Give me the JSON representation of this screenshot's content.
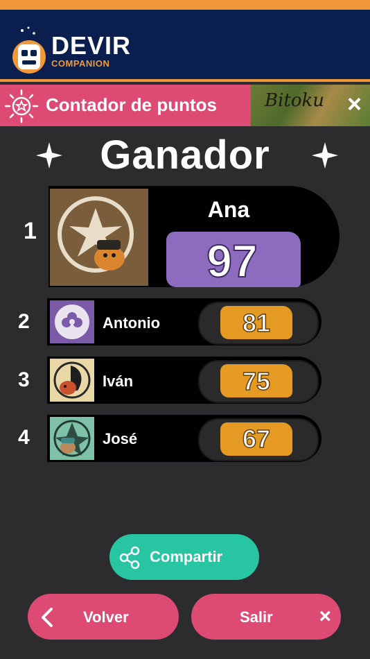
{
  "header": {
    "brand": "DEVIR",
    "brand_sub": "COMPANION"
  },
  "titlebar": {
    "title": "Contador de puntos",
    "banner_game": "Bitoku",
    "close_icon": "×"
  },
  "winner": {
    "title": "Ganador",
    "star_icon": "✦"
  },
  "players": [
    {
      "rank": "1",
      "name": "Ana",
      "score": "97"
    },
    {
      "rank": "2",
      "name": "Antonio",
      "score": "81"
    },
    {
      "rank": "3",
      "name": "Iván",
      "score": "75"
    },
    {
      "rank": "4",
      "name": "José",
      "score": "67"
    }
  ],
  "buttons": {
    "share": "Compartir",
    "back": "Volver",
    "exit": "Salir",
    "exit_icon": "×"
  },
  "colors": {
    "accent_orange": "#f0983a",
    "header_navy": "#0b1f4e",
    "pink": "#dd4a74",
    "teal": "#28c5a2",
    "winner_leaves": "#8d6cc0",
    "score_leaves": "#e59a23"
  }
}
